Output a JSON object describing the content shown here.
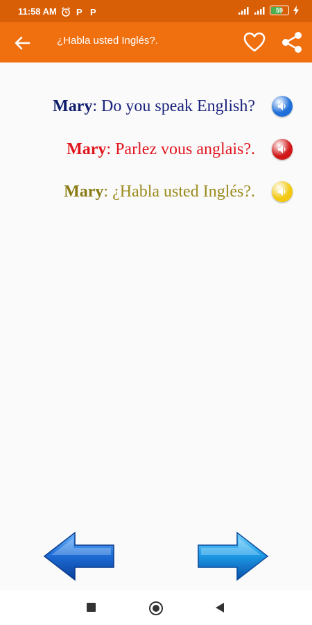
{
  "status_bar": {
    "time": "11:58 AM",
    "battery_level": "59",
    "battery_fraction": 0.59
  },
  "app_bar": {
    "title": "¿Habla usted Inglés?.",
    "back_icon": "arrow-left-icon",
    "favorite_icon": "heart-outline-icon",
    "share_icon": "share-icon"
  },
  "phrases": [
    {
      "speaker": "Mary",
      "separator": ":",
      "text": " Do you speak English?",
      "color": "#1a237e",
      "speaker_color": "#0d1b6b",
      "button_color": "#1e6fd9",
      "language": "english"
    },
    {
      "speaker": "Mary",
      "separator": ":",
      "text": " Parlez vous anglais?.",
      "color": "#e0141c",
      "speaker_color": "#e0141c",
      "button_color": "#d01818",
      "language": "french"
    },
    {
      "speaker": "Mary",
      "separator": ":",
      "text": " ¿Habla usted Inglés?.",
      "color": "#9a8a1c",
      "speaker_color": "#8a7a14",
      "button_color": "#f2c811",
      "language": "spanish"
    }
  ],
  "navigation": {
    "previous_icon": "arrow-left-large-icon",
    "next_icon": "arrow-right-large-icon",
    "arrow_color": "#1e6fd9"
  },
  "colors": {
    "status_bar": "#d95f06",
    "app_bar": "#f07010",
    "background": "#fafafa"
  }
}
